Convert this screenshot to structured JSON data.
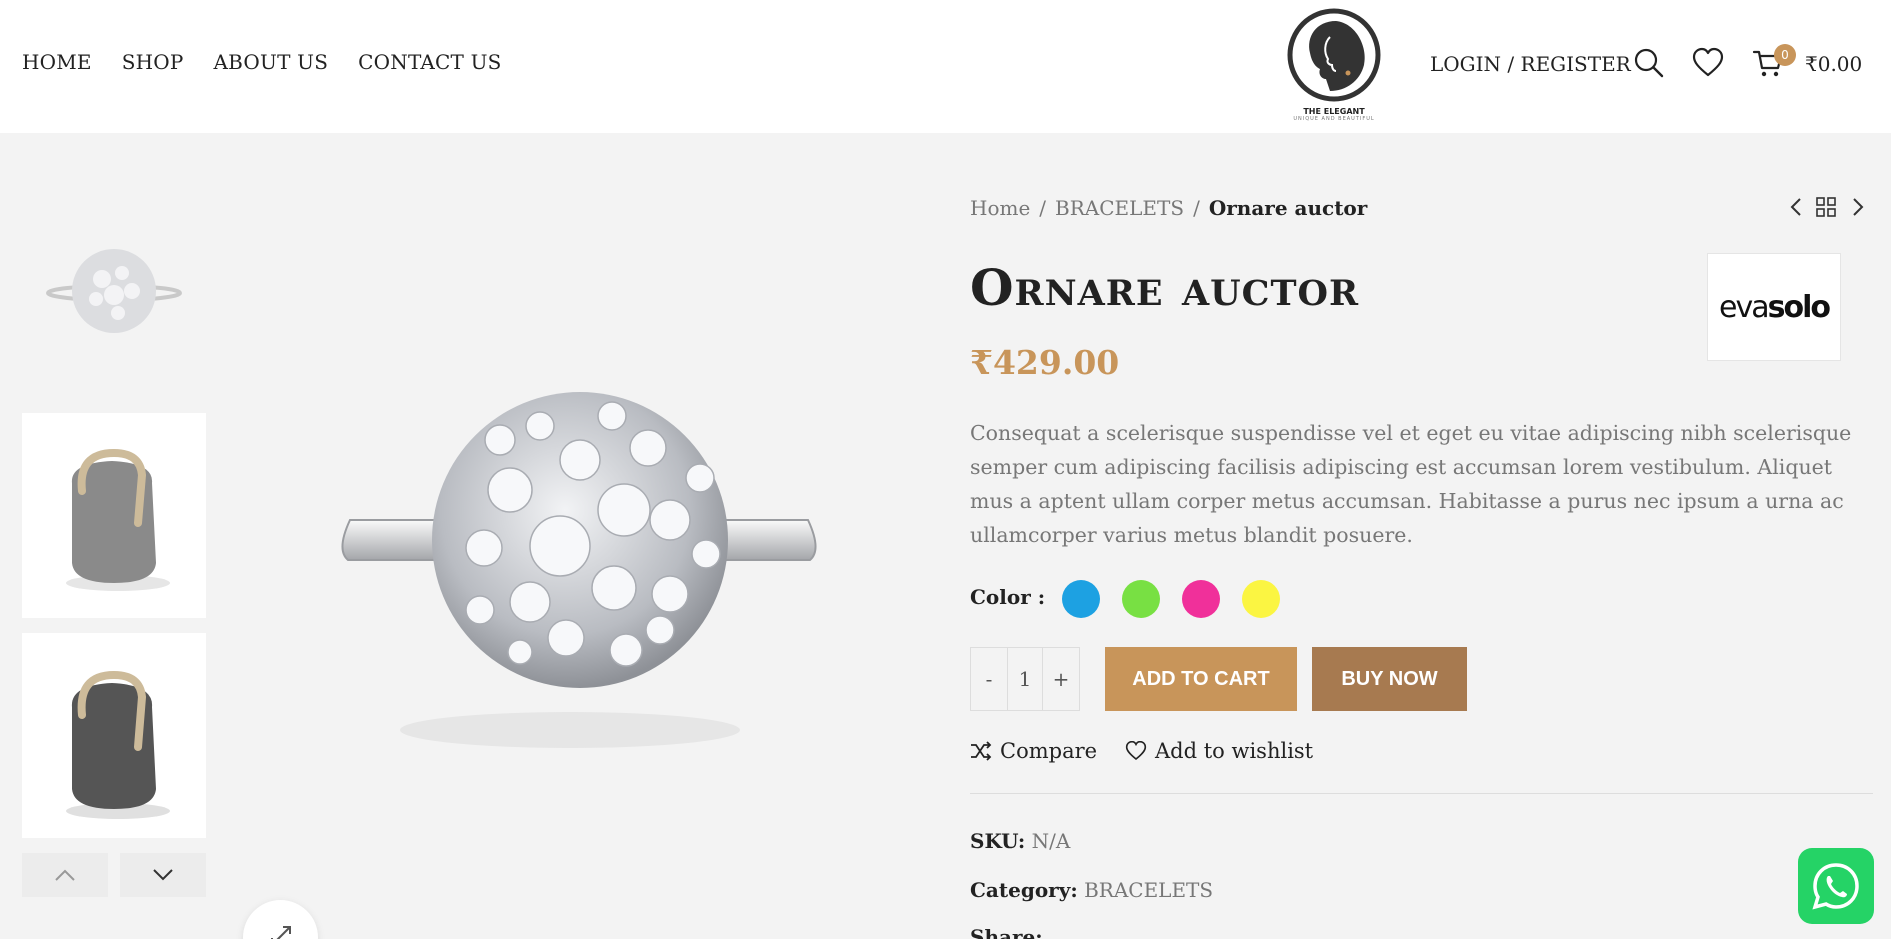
{
  "nav": {
    "items": [
      "HOME",
      "SHOP",
      "ABOUT US",
      "CONTACT US"
    ]
  },
  "logo": {
    "brand": "THE ELEGANT",
    "tagline": "UNIQUE AND BEAUTIFUL"
  },
  "header": {
    "login_label": "LOGIN / REGISTER",
    "cart_count": "0",
    "cart_total": "₹0.00",
    "icons": [
      "search-icon",
      "heart-icon",
      "cart-icon"
    ]
  },
  "gallery": {
    "thumbnails": [
      "diamond-ball-ring",
      "grey-speaker-light",
      "grey-speaker-dark"
    ],
    "nav_icons": [
      "chevron-up-icon",
      "chevron-down-icon"
    ],
    "zoom_icon": "expand-icon"
  },
  "breadcrumb": {
    "home": "Home",
    "category": "BRACELETS",
    "current": "Ornare auctor",
    "sep": "/"
  },
  "product": {
    "title": "Ornare auctor",
    "brand_name_light": "eva",
    "brand_name_bold": "solo",
    "price": "₹429.00",
    "description": "Consequat a scelerisque suspendisse vel et eget eu vitae adipiscing nibh scelerisque semper cum adipiscing facilisis adipiscing est accumsan lorem vestibulum. Aliquet mus a aptent ullam corper metus accumsan. Habitasse a purus nec ipsum a urna ac ullamcorper varius metus blandit posuere.",
    "color_label": "Color",
    "colors": [
      "#1da1e2",
      "#78e043",
      "#f0309a",
      "#fbf542"
    ],
    "quantity": "1",
    "minus": "-",
    "plus": "+",
    "add_to_cart": "ADD TO CART",
    "buy_now": "BUY NOW",
    "compare": "Compare",
    "wishlist": "Add to wishlist",
    "sku_label": "SKU:",
    "sku_value": "N/A",
    "category_label": "Category:",
    "category_value": "BRACELETS",
    "share_label": "Share:"
  },
  "colors": {
    "accent": "#c8955a",
    "accent_dark": "#a77a50",
    "whatsapp": "#25d366"
  }
}
